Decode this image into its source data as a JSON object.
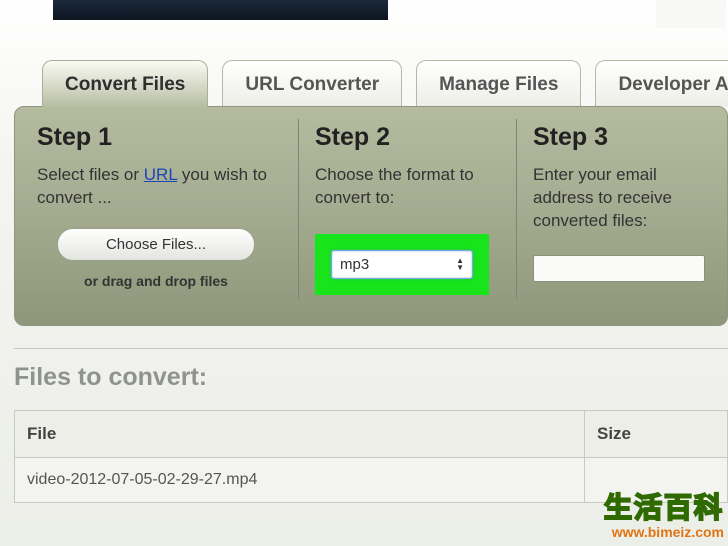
{
  "tabs": [
    "Convert Files",
    "URL Converter",
    "Manage Files",
    "Developer API"
  ],
  "active_tab": 0,
  "steps": [
    {
      "heading": "Step 1",
      "text_before_link": "Select files or ",
      "link_text": "URL",
      "text_after_link": " you wish to convert ...",
      "button_label": "Choose Files...",
      "drag_text": "or drag and drop files"
    },
    {
      "heading": "Step 2",
      "text": "Choose the format to convert to:",
      "select_value": "mp3"
    },
    {
      "heading": "Step 3",
      "text": "Enter your email address to receive converted files:"
    }
  ],
  "files_heading": "Files to convert:",
  "table": {
    "headers": [
      "File",
      "Size"
    ],
    "rows": [
      {
        "file": "video-2012-07-05-02-29-27.mp4",
        "size": ""
      }
    ]
  },
  "watermark": {
    "cn": "生活百科",
    "url": "www.bimeiz.com"
  }
}
